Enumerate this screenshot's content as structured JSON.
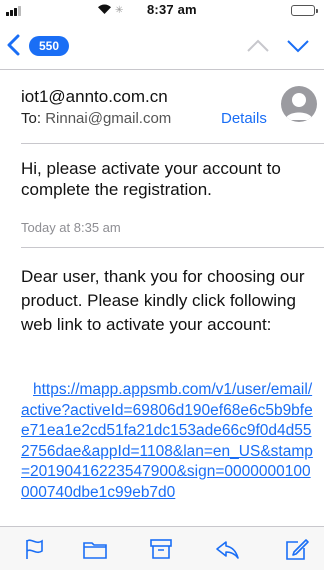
{
  "status_bar": {
    "time": "8:37 am",
    "icons": [
      "signal-icon",
      "wifi-icon",
      "loading-icon",
      "battery-icon"
    ]
  },
  "nav": {
    "unread_count": "550",
    "icons": [
      "back-chevron-icon",
      "up-chevron-icon",
      "down-chevron-icon"
    ],
    "accent_color": "#1a6ef5"
  },
  "header": {
    "from": "iot1@annto.com.cn",
    "to_label": "To:",
    "to_address": "Rinnai@gmail.com",
    "details_label": "Details"
  },
  "message": {
    "subject": "Hi, please activate your account to complete the registration.",
    "date": "Today at 8:35 am",
    "body": "Dear user, thank you for choosing our product. Please kindly click following web link to activate your account:",
    "link": "https://mapp.appsmb.com/v1/user/email/active?activeId=69806d190ef68e6c5b9bfee71ea1e2cd51fa21dc153ade66c9f0d4d552756dae&appId=1108&lan=en_US&stamp=20190416223547900&sign=0000000100000740dbe1c99eb7d0"
  },
  "toolbar": {
    "icons": [
      "flag-icon",
      "folder-icon",
      "archive-icon",
      "reply-icon",
      "compose-icon"
    ]
  }
}
